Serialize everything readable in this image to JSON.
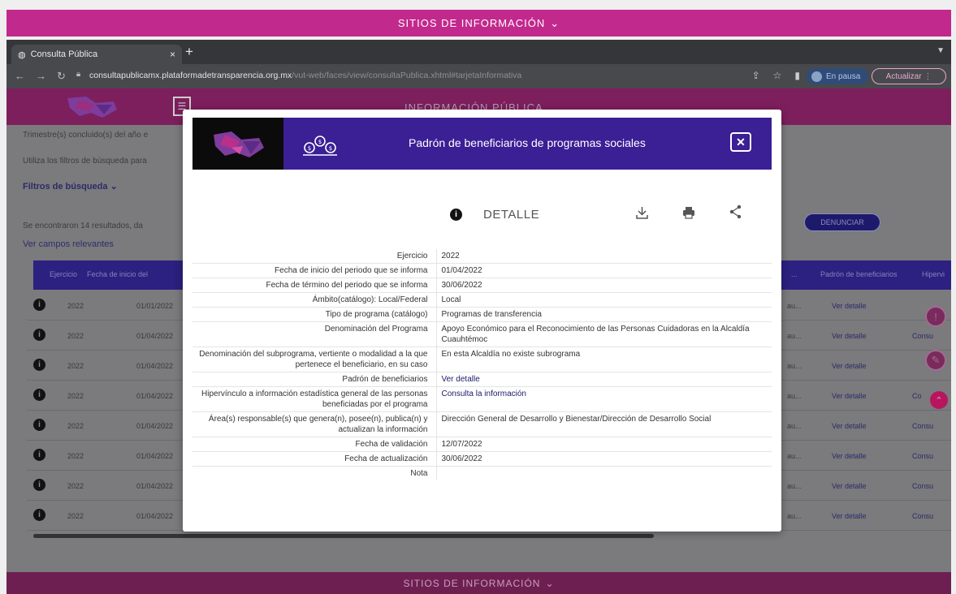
{
  "top_bar": {
    "label": "SITIOS DE INFORMACIÓN"
  },
  "browser": {
    "tab_title": "Consulta Pública",
    "tab_close": "×",
    "new_tab": "+",
    "url_domain": "consultapublicamx.plataformadetransparencia.org.mx",
    "url_path": "/vut-web/faces/view/consultaPublica.xhtml#tarjetaInformativa",
    "profile_status": "En pausa",
    "update_button": "Actualizar"
  },
  "app": {
    "header_title": "INFORMACIÓN PÚBLICA",
    "trimestre_text": "Trimestre(s) concluido(s) del año e",
    "utiliza_text": "Utiliza los filtros de búsqueda para",
    "filtros_label": "Filtros de búsqueda",
    "results_text": "Se encontraron 14 resultados, da",
    "ver_campos": "Ver campos relevantes",
    "denunciar": "DENUNCIAR",
    "table_headers": [
      "Ejercicio",
      "Fecha de inicio del",
      "...",
      "Padrón de beneficiarios",
      "Hipervi"
    ],
    "rows": [
      {
        "ejercicio": "2022",
        "fecha": "01/01/2022",
        "mid": "au...",
        "detalle": "Ver detalle",
        "last": ""
      },
      {
        "ejercicio": "2022",
        "fecha": "01/04/2022",
        "mid": "au...",
        "detalle": "Ver detalle",
        "last": "Consu"
      },
      {
        "ejercicio": "2022",
        "fecha": "01/04/2022",
        "mid": "au...",
        "detalle": "Ver detalle",
        "last": ""
      },
      {
        "ejercicio": "2022",
        "fecha": "01/04/2022",
        "mid": "au...",
        "detalle": "Ver detalle",
        "last": "Co"
      },
      {
        "ejercicio": "2022",
        "fecha": "01/04/2022",
        "mid": "au...",
        "detalle": "Ver detalle",
        "last": "Consu"
      },
      {
        "ejercicio": "2022",
        "fecha": "01/04/2022",
        "mid": "au...",
        "detalle": "Ver detalle",
        "last": "Consu"
      },
      {
        "ejercicio": "2022",
        "fecha": "01/04/2022",
        "mid": "au...",
        "detalle": "Ver detalle",
        "last": "Consu"
      },
      {
        "ejercicio": "2022",
        "fecha": "01/04/2022",
        "mid": "au...",
        "detalle": "Ver detalle",
        "last": "Consu"
      }
    ]
  },
  "modal": {
    "title": "Padrón de beneficiarios de programas sociales",
    "close_label": "✕",
    "detalle_label": "DETALLE",
    "fields": [
      {
        "label": "Ejercicio",
        "value": "2022"
      },
      {
        "label": "Fecha de inicio del periodo que se informa",
        "value": "01/04/2022"
      },
      {
        "label": "Fecha de término del periodo que se informa",
        "value": "30/06/2022"
      },
      {
        "label": "Ámbito(catálogo): Local/Federal",
        "value": "Local"
      },
      {
        "label": "Tipo de programa (catálogo)",
        "value": "Programas de transferencia"
      },
      {
        "label": "Denominación del Programa",
        "value": "Apoyo Económico para el Reconocimiento de las Personas Cuidadoras en la Alcaldía Cuauhtémoc"
      },
      {
        "label": "Denominación del subprograma, vertiente o modalidad a la que pertenece el beneficiario, en su caso",
        "value": "En esta Alcaldía no existe subrograma"
      },
      {
        "label": "Padrón de beneficiarios",
        "value": "Ver detalle"
      },
      {
        "label": "Hipervínculo a información estadística general de las personas beneficiadas por el programa",
        "value": "Consulta la información"
      },
      {
        "label": "Área(s) responsable(s) que genera(n), posee(n), publica(n) y actualizan la información",
        "value": "Dirección General de Desarrollo y Bienestar/Dirección de Desarrollo Social"
      },
      {
        "label": "Fecha de validación",
        "value": "12/07/2022"
      },
      {
        "label": "Fecha de actualización",
        "value": "30/06/2022"
      },
      {
        "label": "Nota",
        "value": ""
      }
    ]
  },
  "bottom_bar": {
    "label": "SITIOS DE INFORMACIÓN"
  },
  "colors": {
    "brand_magenta": "#c2298d",
    "modal_header": "#3a1f95",
    "table_header": "#2c2080"
  }
}
